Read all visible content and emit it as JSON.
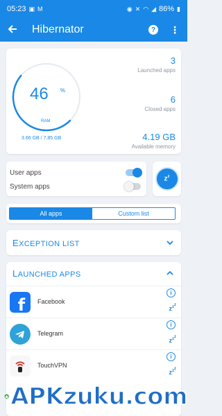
{
  "status_bar": {
    "time": "05:23",
    "battery": "86%"
  },
  "app_bar": {
    "title": "Hibernator"
  },
  "memory_card": {
    "ram_percent": "46",
    "ram_unit": "%",
    "ram_label": "RAM",
    "ram_usage": "3.66 GB / 7.85 GB",
    "ram_fraction": 0.46,
    "launched_count": "3",
    "launched_label": "Launched apps",
    "closed_count": "6",
    "closed_label": "Closed apps",
    "available_memory": "4.19 GB",
    "available_label": "Available memory"
  },
  "toggles": {
    "user_apps_label": "User apps",
    "user_apps_on": true,
    "system_apps_label": "System apps",
    "system_apps_on": false
  },
  "tabs": {
    "all_apps": "All apps",
    "custom_list": "Custom list"
  },
  "exception_list": {
    "first_letter": "E",
    "rest": "XCEPTION LIST"
  },
  "launched_apps": {
    "first_letter": "L",
    "rest": "AUNCHED APPS",
    "items": [
      {
        "name": "Facebook",
        "icon": "facebook-icon"
      },
      {
        "name": "Telegram",
        "icon": "telegram-icon"
      },
      {
        "name": "TouchVPN",
        "icon": "touchvpn-icon"
      }
    ]
  },
  "watermark": {
    "text": "APKzuku.com"
  },
  "colors": {
    "accent": "#1a88e6",
    "background": "#eef1f5"
  }
}
